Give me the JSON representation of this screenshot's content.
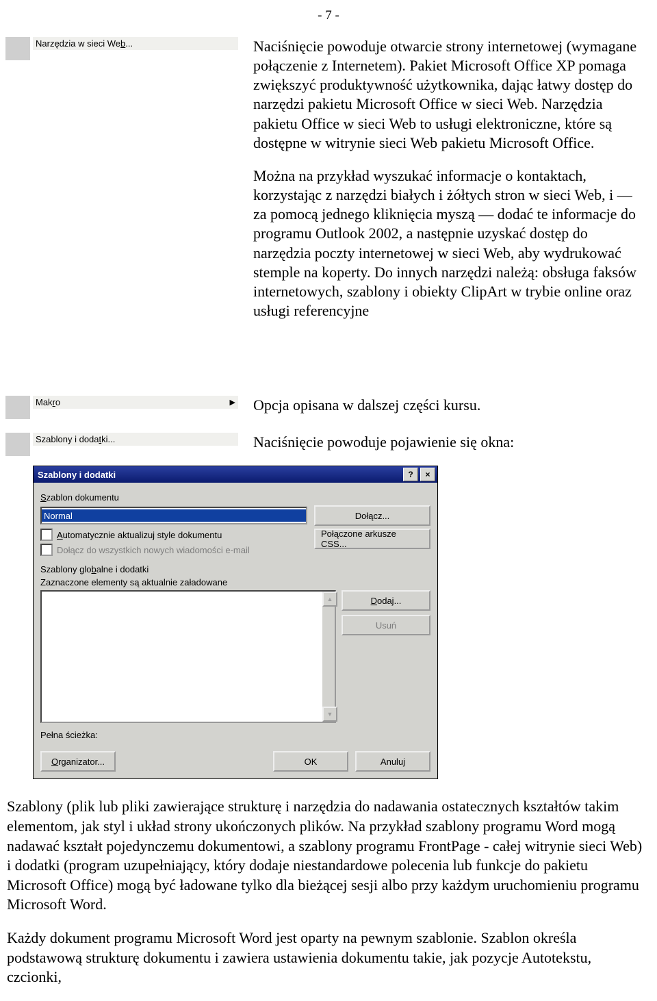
{
  "page_number": "- 7 -",
  "menu": {
    "web_tools": "Narzędzia w sieci Web...",
    "makro": "Makro",
    "templates": "Szablony i dodatki..."
  },
  "section1": {
    "p1": "Naciśnięcie powoduje otwarcie strony internetowej (wymagane połączenie z Internetem). Pakiet Microsoft Office XP pomaga zwiększyć produktywność użytkownika, dając łatwy dostęp do narzędzi pakietu Microsoft Office w sieci Web. Narzędzia pakietu Office w sieci Web to usługi elektroniczne, które są dostępne w witrynie sieci Web pakietu Microsoft Office.",
    "p2": "Można na przykład wyszukać informacje o kontaktach, korzystając z narzędzi białych i żółtych stron w sieci Web, i — za pomocą jednego kliknięcia myszą — dodać te informacje do programu Outlook 2002, a następnie uzyskać dostęp do narzędzia poczty internetowej w sieci Web, aby wydrukować stemple na koperty. Do innych narzędzi należą: obsługa faksów internetowych, szablony i obiekty ClipArt w trybie online oraz usługi referencyjne"
  },
  "section2": {
    "p1": "Opcja opisana w dalszej części kursu.",
    "p2": "Naciśnięcie powoduje pojawienie się okna:"
  },
  "dialog": {
    "title": "Szablony i dodatki",
    "help": "?",
    "close": "×",
    "doc_template_label": "Szablon dokumentu",
    "doc_template_value": "Normal",
    "attach_btn": "Dołącz...",
    "css_btn": "Połączone arkusze CSS...",
    "auto_update": "Automatycznie aktualizuj style dokumentu",
    "attach_all": "Dołącz do wszystkich nowych wiadomości e-mail",
    "globals_label": "Szablony globalne i dodatki",
    "globals_hint": "Zaznaczone elementy są aktualnie załadowane",
    "add_btn": "Dodaj...",
    "remove_btn": "Usuń",
    "fullpath": "Pełna ścieżka:",
    "organizer_btn": "Organizator...",
    "ok_btn": "OK",
    "cancel_btn": "Anuluj"
  },
  "footer": {
    "p1": "Szablony (plik lub pliki zawierające strukturę i narzędzia do nadawania ostatecznych kształtów takim elementom, jak styl i układ strony ukończonych plików. Na przykład szablony programu Word mogą nadawać kształt pojedynczemu dokumentowi, a szablony programu FrontPage - całej witrynie sieci Web) i dodatki (program uzupełniający, który dodaje niestandardowe polecenia lub funkcje do pakietu Microsoft Office) mogą być ładowane tylko dla bieżącej sesji albo przy każdym uruchomieniu programu Microsoft Word.",
    "p2": "Każdy dokument programu Microsoft Word jest oparty na pewnym szablonie. Szablon określa podstawową strukturę dokumentu i zawiera ustawienia dokumentu takie, jak pozycje Autotekstu, czcionki,"
  }
}
